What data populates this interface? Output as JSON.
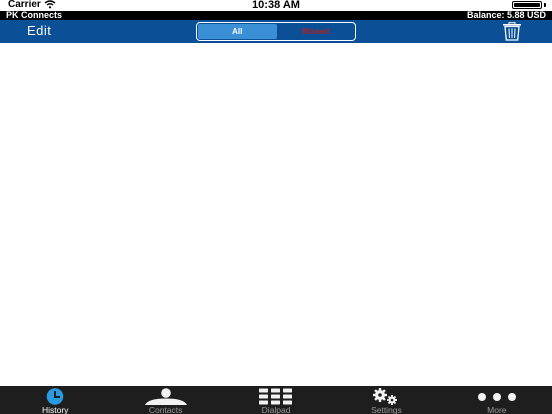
{
  "status_bar": {
    "carrier": "Carrier",
    "time": "10:38 AM"
  },
  "info_bar": {
    "app_name": "PK Connects",
    "balance": "Balance: 5.88 USD"
  },
  "nav_bar": {
    "edit_label": "Edit",
    "segments": [
      {
        "label": "All",
        "selected": true
      },
      {
        "label": "Missed",
        "selected": false
      }
    ],
    "trash_icon": "trash-icon"
  },
  "tab_bar": {
    "tabs": [
      {
        "label": "History",
        "icon": "clock-icon",
        "active": true
      },
      {
        "label": "Contacts",
        "icon": "person-icon",
        "active": false
      },
      {
        "label": "Dialpad",
        "icon": "dialpad-icon",
        "active": false
      },
      {
        "label": "Settings",
        "icon": "gears-icon",
        "active": false
      },
      {
        "label": "More",
        "icon": "more-dots-icon",
        "active": false
      }
    ]
  },
  "colors": {
    "nav_blue": "#0b4f97",
    "segment_selected": "#3b8fd6",
    "missed_red": "#b21f1f",
    "tab_bar_bg": "#1e1e1e",
    "active_icon": "#2a9be0"
  }
}
